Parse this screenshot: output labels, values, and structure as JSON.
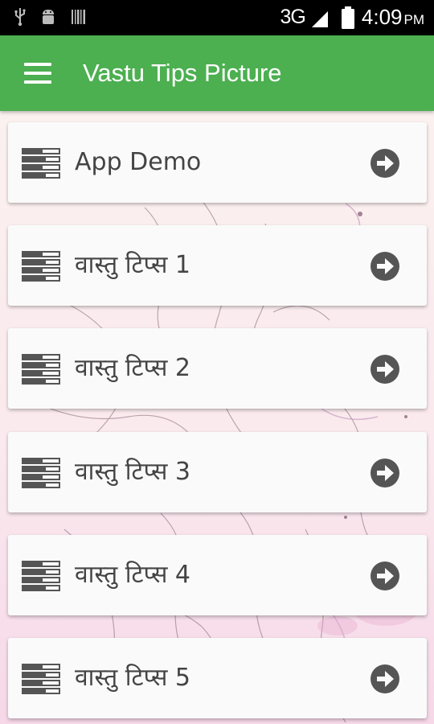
{
  "status_bar": {
    "network": "3G",
    "time": "4:09",
    "ampm": "PM",
    "icons": [
      "usb-icon",
      "android-icon",
      "barcode-icon",
      "signal-icon",
      "battery-icon"
    ]
  },
  "app_bar": {
    "title": "Vastu Tips Picture",
    "menu_icon": "hamburger-menu-icon",
    "color": "#4caf50"
  },
  "list": {
    "item_icon": "list-icon",
    "arrow_icon": "arrow-circle-right-icon",
    "items": [
      {
        "label": "App Demo"
      },
      {
        "label": "वास्तु टिप्स 1"
      },
      {
        "label": "वास्तु टिप्स 2"
      },
      {
        "label": "वास्तु टिप्स 3"
      },
      {
        "label": "वास्तु टिप्स 4"
      },
      {
        "label": "वास्तु टिप्स 5"
      }
    ]
  }
}
